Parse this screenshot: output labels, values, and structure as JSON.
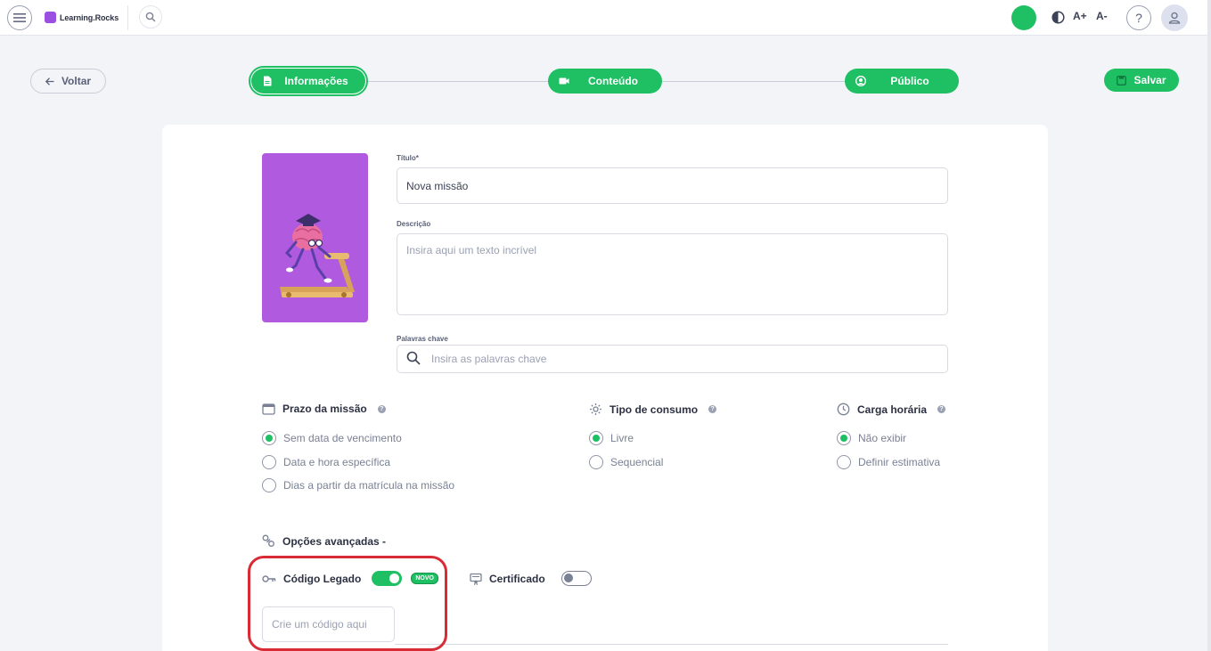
{
  "topbar": {
    "brand": "Learning.Rocks",
    "add_label": "+",
    "font_increase": "A+",
    "font_decrease": "A-",
    "help_label": "?"
  },
  "nav": {
    "back_label": "Voltar",
    "steps": [
      {
        "label": "Informações",
        "icon": "document-icon",
        "active": true
      },
      {
        "label": "Conteúdo",
        "icon": "video-icon",
        "active": false
      },
      {
        "label": "Público",
        "icon": "user-circle-icon",
        "active": false
      }
    ],
    "save_label": "Salvar"
  },
  "form": {
    "title_label": "Título*",
    "title_value": "Nova missão",
    "description_label": "Descrição",
    "description_placeholder": "Insira aqui um texto incrível",
    "keywords_label": "Palavras chave",
    "keywords_placeholder": "Insira as palavras chave"
  },
  "deadline": {
    "title": "Prazo da missão",
    "options": [
      {
        "label": "Sem data de vencimento",
        "selected": true
      },
      {
        "label": "Data e hora específica",
        "selected": false
      },
      {
        "label": "Dias a partir da matrícula na missão",
        "selected": false
      }
    ]
  },
  "consumption": {
    "title": "Tipo de consumo",
    "options": [
      {
        "label": "Livre",
        "selected": true
      },
      {
        "label": "Sequencial",
        "selected": false
      }
    ]
  },
  "workload": {
    "title": "Carga horária",
    "options": [
      {
        "label": "Não exibir",
        "selected": true
      },
      {
        "label": "Definir estimativa",
        "selected": false
      }
    ]
  },
  "advanced": {
    "title": "Opções avançadas -",
    "legacy_code_label": "Código Legado",
    "legacy_code_enabled": true,
    "new_badge": "NOVO",
    "certificate_label": "Certificado",
    "certificate_enabled": false,
    "code_placeholder": "Crie um código aqui"
  },
  "colors": {
    "accent": "#1fbf63",
    "cover": "#b05ae0",
    "highlight": "#d92b35"
  }
}
